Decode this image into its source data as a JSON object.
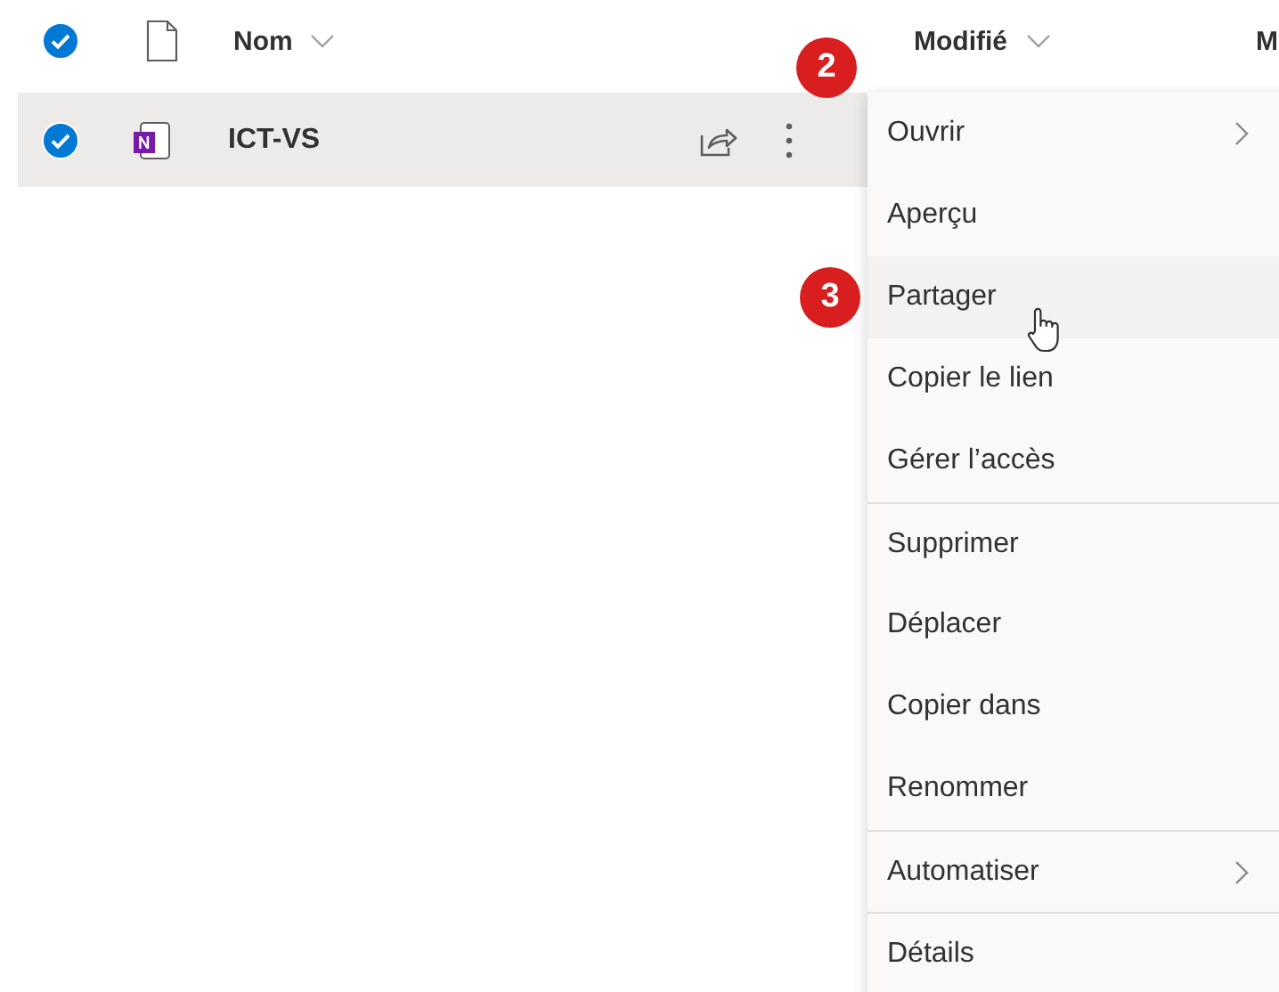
{
  "header": {
    "all_selected": true,
    "columns": [
      {
        "label": "Nom",
        "sortable": true
      },
      {
        "label": "Modifié",
        "sortable": true
      },
      {
        "label": "M",
        "sortable": false
      }
    ]
  },
  "rows": [
    {
      "name": "ICT-VS",
      "selected": true,
      "kind": "onenote",
      "callout": "2"
    }
  ],
  "context_menu": {
    "items": [
      {
        "label": "Ouvrir",
        "submenu": true,
        "hovered": false,
        "divider_before": false
      },
      {
        "label": "Aperçu",
        "submenu": false,
        "hovered": false,
        "divider_before": false
      },
      {
        "label": "Partager",
        "submenu": false,
        "hovered": true,
        "divider_before": false,
        "callout": "3"
      },
      {
        "label": "Copier le lien",
        "submenu": false,
        "hovered": false,
        "divider_before": false
      },
      {
        "label": "Gérer l’accès",
        "submenu": false,
        "hovered": false,
        "divider_before": false
      },
      {
        "label": "Supprimer",
        "submenu": false,
        "hovered": false,
        "divider_before": true
      },
      {
        "label": "Déplacer",
        "submenu": false,
        "hovered": false,
        "divider_before": false
      },
      {
        "label": "Copier dans",
        "submenu": false,
        "hovered": false,
        "divider_before": false
      },
      {
        "label": "Renommer",
        "submenu": false,
        "hovered": false,
        "divider_before": false
      },
      {
        "label": "Automatiser",
        "submenu": true,
        "hovered": false,
        "divider_before": true
      },
      {
        "label": "Détails",
        "submenu": false,
        "hovered": false,
        "divider_before": true
      }
    ]
  }
}
